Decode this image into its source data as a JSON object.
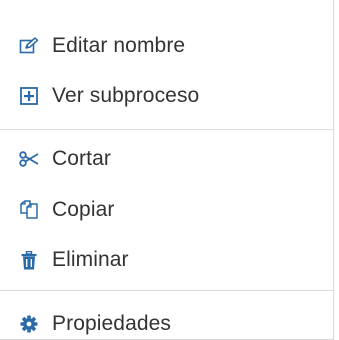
{
  "menu": {
    "accent_color": "#2b6aa8",
    "groups": [
      {
        "items": [
          {
            "label": "Editar nombre",
            "icon": "edit-icon"
          },
          {
            "label": "Ver subproceso",
            "icon": "plus-square-icon"
          }
        ]
      },
      {
        "items": [
          {
            "label": "Cortar",
            "icon": "scissors-icon"
          },
          {
            "label": "Copiar",
            "icon": "copy-icon"
          },
          {
            "label": "Eliminar",
            "icon": "trash-icon"
          }
        ]
      },
      {
        "items": [
          {
            "label": "Propiedades",
            "icon": "gear-icon"
          }
        ]
      }
    ]
  }
}
